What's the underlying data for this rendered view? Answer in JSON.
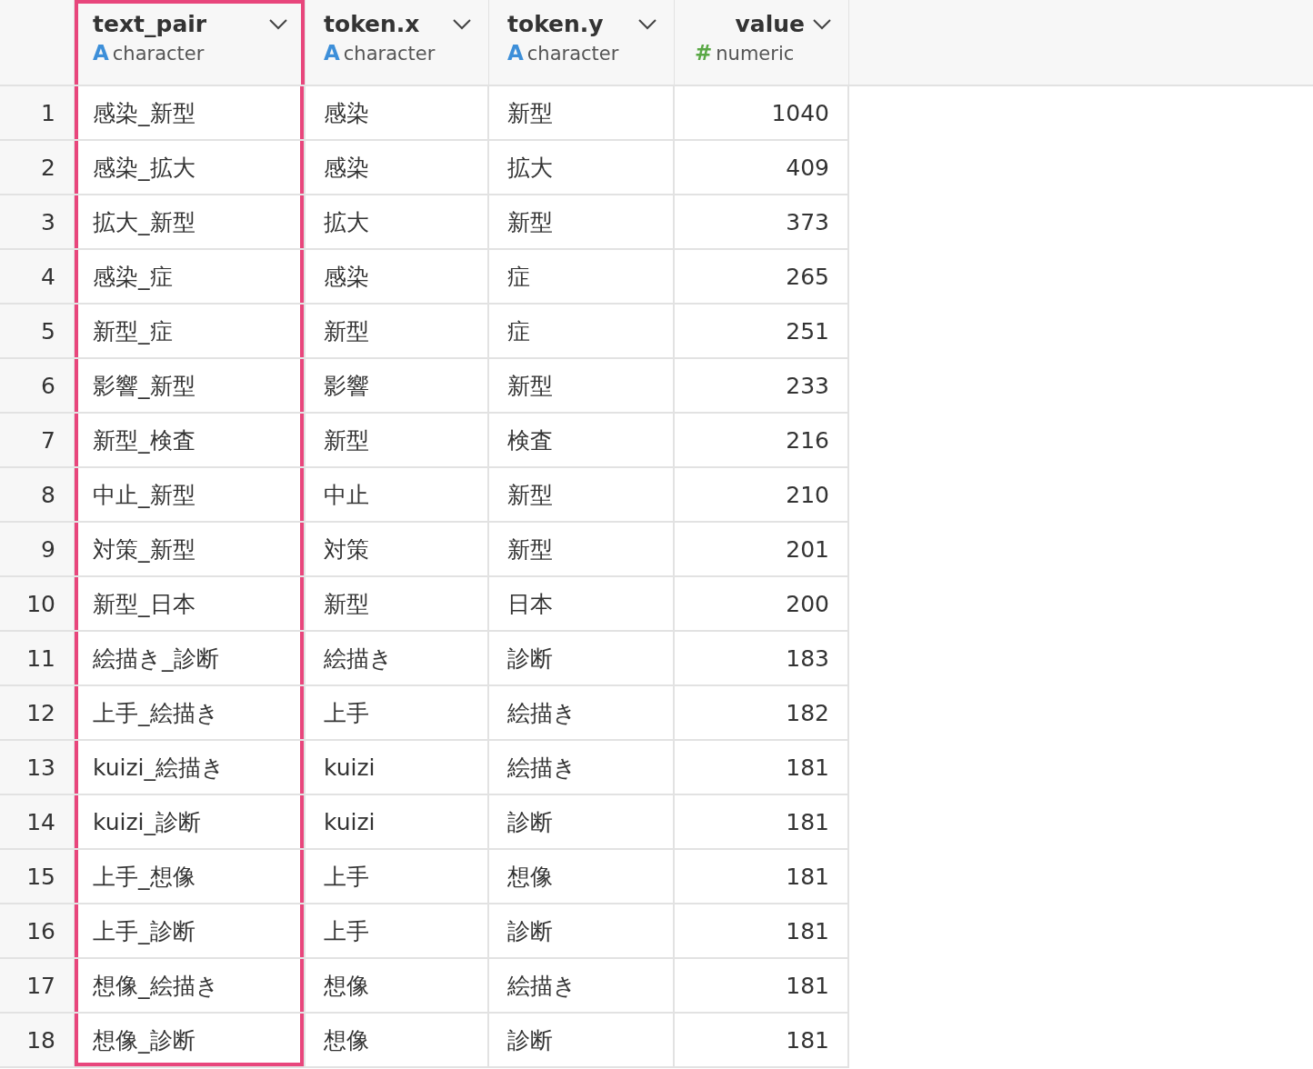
{
  "columns": [
    {
      "name": "text_pair",
      "type_icon": "A",
      "type": "character",
      "kind": "text",
      "selected": true
    },
    {
      "name": "token.x",
      "type_icon": "A",
      "type": "character",
      "kind": "text",
      "selected": false
    },
    {
      "name": "token.y",
      "type_icon": "A",
      "type": "character",
      "kind": "text",
      "selected": false
    },
    {
      "name": "value",
      "type_icon": "#",
      "type": "numeric",
      "kind": "number",
      "selected": false
    }
  ],
  "rows": [
    {
      "index": "1",
      "cells": [
        "感染_新型",
        "感染",
        "新型",
        "1040"
      ]
    },
    {
      "index": "2",
      "cells": [
        "感染_拡大",
        "感染",
        "拡大",
        "409"
      ]
    },
    {
      "index": "3",
      "cells": [
        "拡大_新型",
        "拡大",
        "新型",
        "373"
      ]
    },
    {
      "index": "4",
      "cells": [
        "感染_症",
        "感染",
        "症",
        "265"
      ]
    },
    {
      "index": "5",
      "cells": [
        "新型_症",
        "新型",
        "症",
        "251"
      ]
    },
    {
      "index": "6",
      "cells": [
        "影響_新型",
        "影響",
        "新型",
        "233"
      ]
    },
    {
      "index": "7",
      "cells": [
        "新型_検査",
        "新型",
        "検査",
        "216"
      ]
    },
    {
      "index": "8",
      "cells": [
        "中止_新型",
        "中止",
        "新型",
        "210"
      ]
    },
    {
      "index": "9",
      "cells": [
        "対策_新型",
        "対策",
        "新型",
        "201"
      ]
    },
    {
      "index": "10",
      "cells": [
        "新型_日本",
        "新型",
        "日本",
        "200"
      ]
    },
    {
      "index": "11",
      "cells": [
        "絵描き_診断",
        "絵描き",
        "診断",
        "183"
      ]
    },
    {
      "index": "12",
      "cells": [
        "上手_絵描き",
        "上手",
        "絵描き",
        "182"
      ]
    },
    {
      "index": "13",
      "cells": [
        "kuizi_絵描き",
        "kuizi",
        "絵描き",
        "181"
      ]
    },
    {
      "index": "14",
      "cells": [
        "kuizi_診断",
        "kuizi",
        "診断",
        "181"
      ]
    },
    {
      "index": "15",
      "cells": [
        "上手_想像",
        "上手",
        "想像",
        "181"
      ]
    },
    {
      "index": "16",
      "cells": [
        "上手_診断",
        "上手",
        "診断",
        "181"
      ]
    },
    {
      "index": "17",
      "cells": [
        "想像_絵描き",
        "想像",
        "絵描き",
        "181"
      ]
    },
    {
      "index": "18",
      "cells": [
        "想像_診断",
        "想像",
        "診断",
        "181"
      ]
    }
  ]
}
